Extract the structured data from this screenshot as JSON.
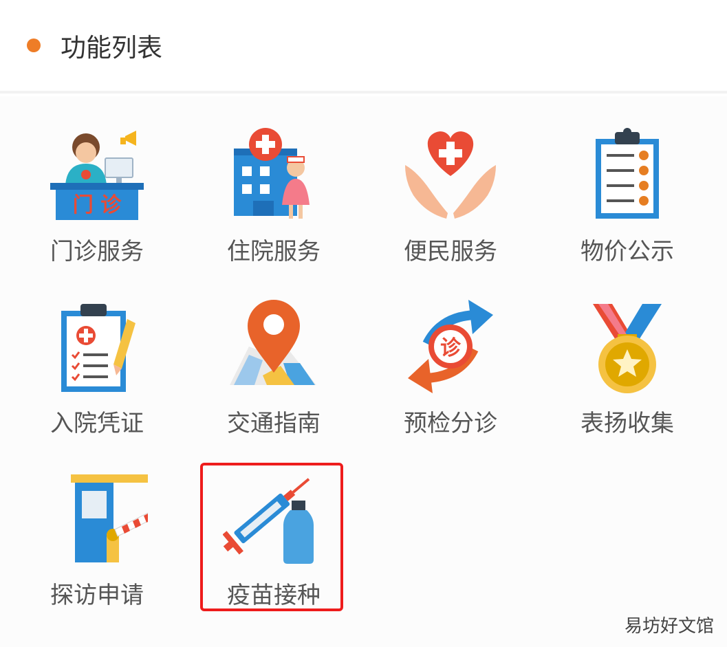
{
  "header": {
    "title": "功能列表",
    "dot_color": "#ee7d27"
  },
  "items": [
    {
      "label": "门诊服务",
      "icon": "outpatient-desk-icon",
      "icon_text": "门 诊"
    },
    {
      "label": "住院服务",
      "icon": "hospital-building-icon"
    },
    {
      "label": "便民服务",
      "icon": "heart-hands-icon"
    },
    {
      "label": "物价公示",
      "icon": "clipboard-list-icon"
    },
    {
      "label": "入院凭证",
      "icon": "medical-clipboard-icon"
    },
    {
      "label": "交通指南",
      "icon": "map-pin-icon"
    },
    {
      "label": "预检分诊",
      "icon": "triage-arrows-icon",
      "icon_text": "诊"
    },
    {
      "label": "表扬收集",
      "icon": "medal-icon"
    },
    {
      "label": "探访申请",
      "icon": "gate-barrier-icon"
    },
    {
      "label": "疫苗接种",
      "icon": "vaccine-syringe-icon",
      "selected": true
    }
  ],
  "highlight_color": "#ee1c1c",
  "watermark": "易坊好文馆"
}
